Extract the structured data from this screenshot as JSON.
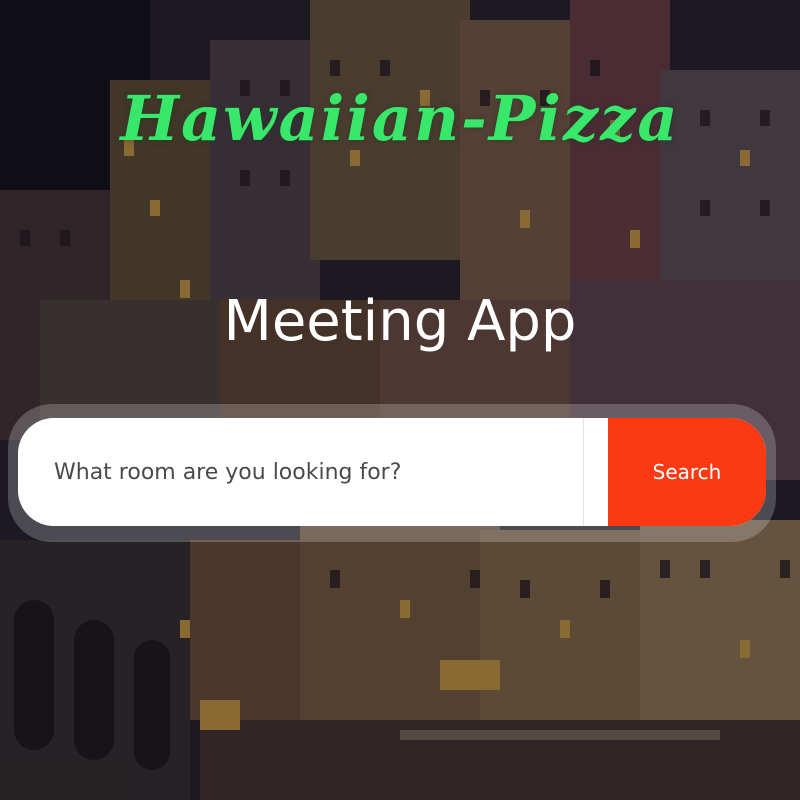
{
  "header": {
    "brand": "Hawaiian-Pizza",
    "app_title": "Meeting App"
  },
  "search": {
    "placeholder": "What room are you looking for?",
    "value": "",
    "button_label": "Search"
  },
  "colors": {
    "brand": "#39e86b",
    "accent": "#fb3a13",
    "title": "#ffffff"
  }
}
